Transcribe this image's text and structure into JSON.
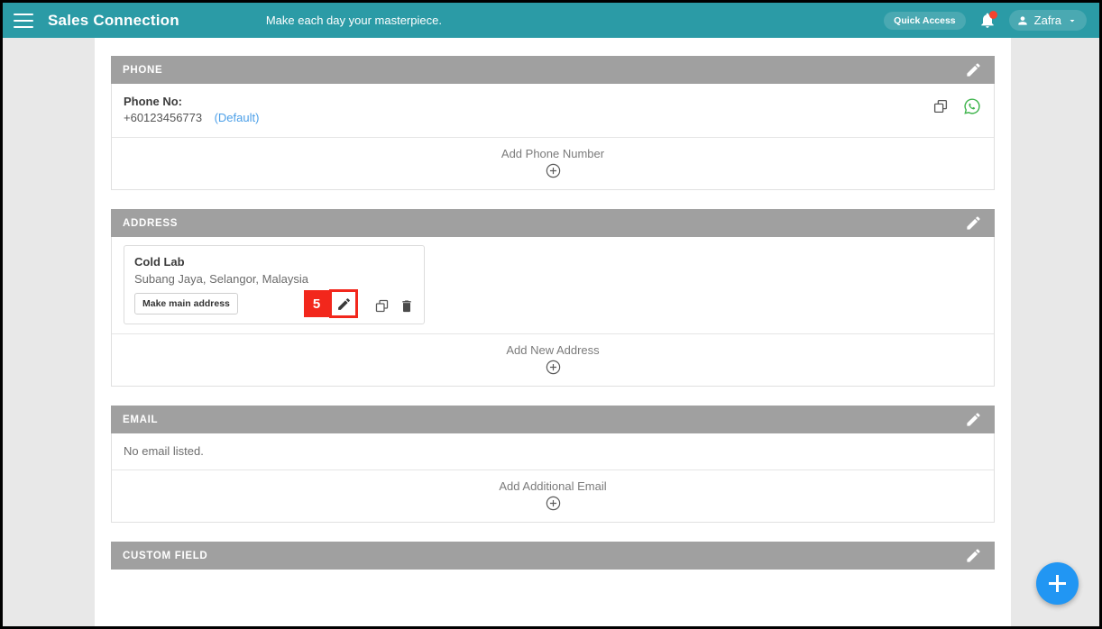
{
  "header": {
    "menu_icon": "hamburger-icon",
    "brand": "Sales Connection",
    "tagline": "Make each day your masterpiece.",
    "quick_access_label": "Quick Access",
    "bell_icon": "notification-bell-icon",
    "has_notification": true,
    "user_name": "Zafra",
    "user_icon": "person-icon",
    "chevron_icon": "chevron-down-icon",
    "accent_color": "#2b9ba6"
  },
  "sections": {
    "phone": {
      "title": "PHONE",
      "edit_icon": "pencil-icon",
      "label": "Phone No:",
      "value": "+60123456773",
      "default_tag": "(Default)",
      "copy_icon": "copy-icon",
      "whatsapp_icon": "whatsapp-icon",
      "whatsapp_color": "#3cb34a",
      "add_label": "Add Phone Number",
      "add_icon": "plus-circle-icon"
    },
    "address": {
      "title": "ADDRESS",
      "edit_icon": "pencil-icon",
      "name": "Cold Lab",
      "detail": "Subang Jaya, Selangor, Malaysia",
      "make_main_label": "Make main address",
      "edit_item_icon": "pencil-icon",
      "copy_icon": "copy-icon",
      "delete_icon": "trash-icon",
      "add_label": "Add New Address",
      "add_icon": "plus-circle-icon"
    },
    "email": {
      "title": "EMAIL",
      "edit_icon": "pencil-icon",
      "empty_text": "No email listed.",
      "add_label": "Add Additional Email",
      "add_icon": "plus-circle-icon"
    },
    "custom_field": {
      "title": "CUSTOM FIELD",
      "edit_icon": "pencil-icon"
    }
  },
  "annotation": {
    "step_number": "5",
    "highlight_color": "#f2271c"
  },
  "fab": {
    "icon": "plus-icon",
    "color": "#2196f3"
  }
}
